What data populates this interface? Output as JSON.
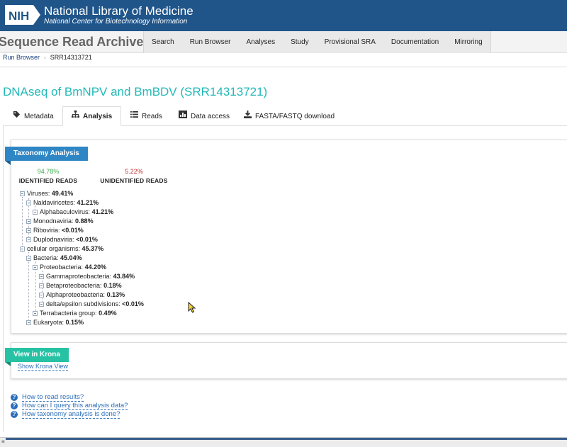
{
  "nih": {
    "logo_text": "NIH",
    "title": "National Library of Medicine",
    "subtitle": "National Center for Biotechnology Information"
  },
  "sra": {
    "title": "Sequence Read Archive",
    "nav": [
      "Search",
      "Run Browser",
      "Analyses",
      "Study",
      "Provisional SRA",
      "Documentation",
      "Mirroring"
    ]
  },
  "breadcrumb": {
    "parent": "Run Browser",
    "separator": "›",
    "current": "SRR14313721"
  },
  "run": {
    "title": "DNAseq of BmNPV and BmBDV (SRR14313721)"
  },
  "tabs": [
    {
      "label": "Metadata",
      "icon": "tag-icon"
    },
    {
      "label": "Analysis",
      "icon": "hierarchy-icon"
    },
    {
      "label": "Reads",
      "icon": "list-icon"
    },
    {
      "label": "Data access",
      "icon": "data-access-icon"
    },
    {
      "label": "FASTA/FASTQ download",
      "icon": "download-icon"
    }
  ],
  "taxonomy": {
    "ribbon": "Taxonomy Analysis",
    "identified": {
      "pct": "94.78%",
      "label": "IDENTIFIED READS"
    },
    "unidentified": {
      "pct": "5.22%",
      "label": "UNIDENTIFIED READS"
    },
    "tree": [
      {
        "name": "Viruses:",
        "value": "49.41%"
      },
      {
        "name": "Naldaviricetes:",
        "value": "41.21%"
      },
      {
        "name": "Alphabaculovirus:",
        "value": "41.21%"
      },
      {
        "name": "Monodnaviria:",
        "value": "0.88%"
      },
      {
        "name": "Riboviria:",
        "value": "<0.01%"
      },
      {
        "name": "Duplodnaviria:",
        "value": "<0.01%"
      },
      {
        "name": "cellular organisms:",
        "value": "45.37%"
      },
      {
        "name": "Bacteria:",
        "value": "45.04%"
      },
      {
        "name": "Proteobacteria:",
        "value": "44.20%"
      },
      {
        "name": "Gammaproteobacteria:",
        "value": "43.84%"
      },
      {
        "name": "Betaproteobacteria:",
        "value": "0.18%"
      },
      {
        "name": "Alphaproteobacteria:",
        "value": "0.13%"
      },
      {
        "name": "delta/epsilon subdivisions:",
        "value": "<0.01%"
      },
      {
        "name": "Terrabacteria group:",
        "value": "0.49%"
      },
      {
        "name": "Eukaryota:",
        "value": "0.15%"
      }
    ]
  },
  "krona": {
    "ribbon": "View in Krona",
    "link": "Show Krona View"
  },
  "help": {
    "icon": "?",
    "links": [
      "How to read results?",
      "How can I query this analysis data?",
      "How taxonomy analysis is done?"
    ]
  },
  "bottom": {
    "mark": "≡"
  },
  "colors": {
    "nih_blue": "#20558a",
    "title_teal": "#22b8b8",
    "ribbon_blue": "#2f86c4",
    "ribbon_teal": "#27c2a4",
    "identified_green": "#3fae4f",
    "unidentified_red": "#c62f2f",
    "link_blue": "#2a6ebb"
  }
}
